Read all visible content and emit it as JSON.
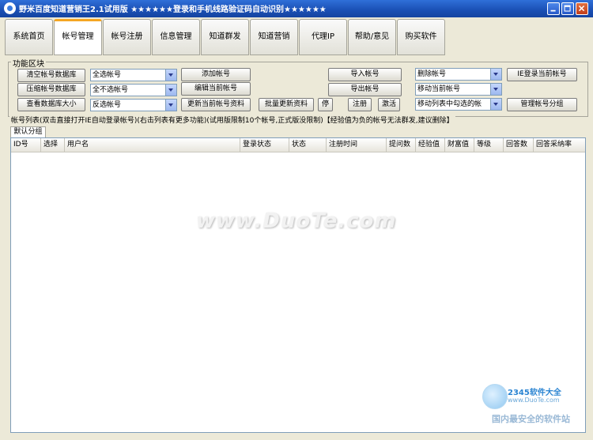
{
  "window": {
    "title": "野米百度知道营销王2.1试用版 ★★★★★★登录和手机线路验证码自动识别★★★★★★"
  },
  "tabs": [
    {
      "label": "系统首页"
    },
    {
      "label": "帐号管理"
    },
    {
      "label": "帐号注册"
    },
    {
      "label": "信息管理"
    },
    {
      "label": "知道群发"
    },
    {
      "label": "知道营销"
    },
    {
      "label": "代理IP"
    },
    {
      "label": "帮助/意见"
    },
    {
      "label": "购买软件"
    }
  ],
  "active_tab": "帐号管理",
  "function_area": {
    "title": "功能区块",
    "buttons": {
      "clear_db": "清空帐号数据库",
      "compress_db": "压缩帐号数据库",
      "view_db_size": "查看数据库大小",
      "add_account": "添加帐号",
      "edit_account": "编辑当前帐号",
      "update_account": "更新当前帐号资料",
      "batch_update": "批量更新资料",
      "stop": "停",
      "register": "注册",
      "activate": "激活",
      "import": "导入帐号",
      "export": "导出帐号",
      "ie_login": "IE登录当前帐号",
      "manage_groups": "管理帐号分组"
    },
    "selects": {
      "select_all": "全选帐号",
      "select_none": "全不选帐号",
      "invert": "反选帐号",
      "delete": "删除帐号",
      "move_current": "移动当前帐号",
      "move_checked": "移动列表中勾选的帐"
    }
  },
  "account_list": {
    "caption": "帐号列表(双击直接打开IE自动登录帐号)(右击列表有更多功能)(试用版限制10个帐号,正式版没限制)【经验值为负的帐号无法群发,建议删除】",
    "group_tab": "默认分组",
    "columns": [
      "ID号",
      "选择",
      "用户名",
      "登录状态",
      "状态",
      "注册时间",
      "提问数",
      "经验值",
      "财富值",
      "等级",
      "回答数",
      "回答采纳率"
    ]
  },
  "watermark": "www.DuoTe.com",
  "logo": {
    "brand": "2345软件大全",
    "url": "www.DuoTe.com",
    "slogan": "国内最安全的软件站"
  }
}
